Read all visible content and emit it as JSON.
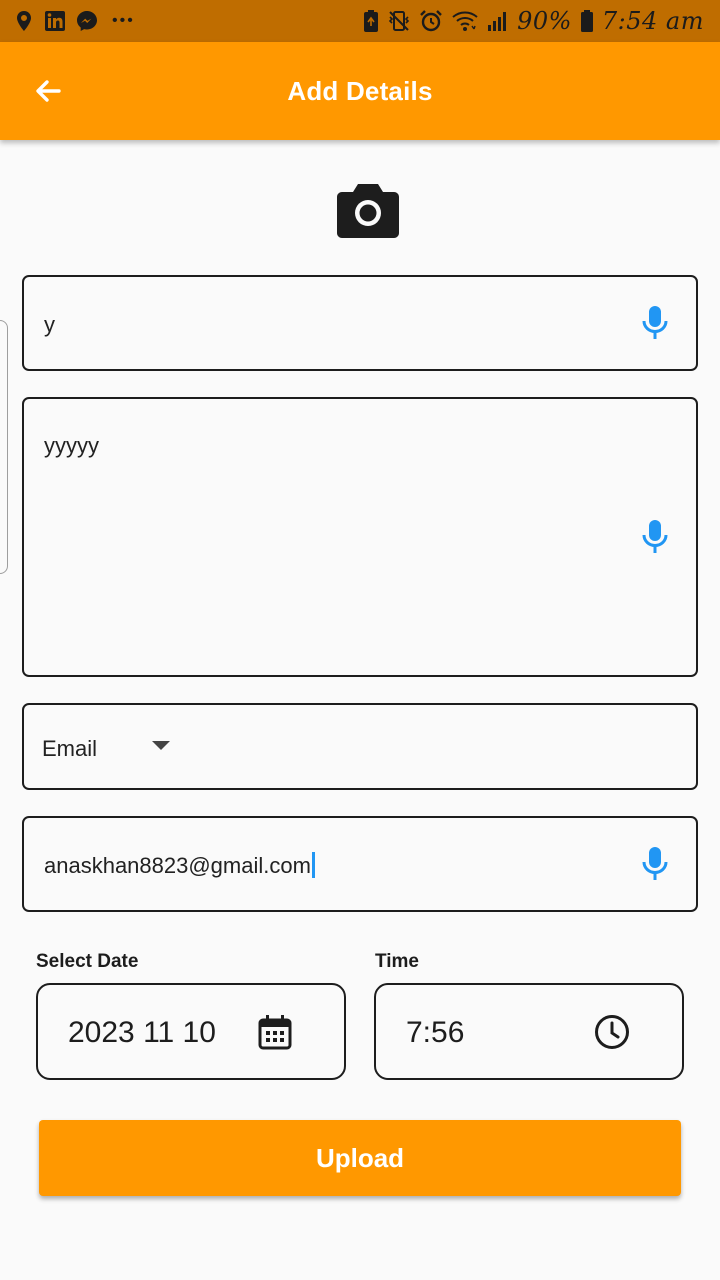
{
  "status_bar": {
    "icons_left": [
      "location-pin-icon",
      "linkedin-icon",
      "messenger-icon",
      "more-dots-icon"
    ],
    "more_dots": "•••",
    "icons_right": [
      "battery-saver-icon",
      "vibrate-icon",
      "alarm-icon",
      "wifi-icon",
      "signal-icon",
      "battery-icon"
    ],
    "battery_text": "90%",
    "time_text": "7:54 am"
  },
  "app_bar": {
    "title": "Add Details",
    "back_icon": "arrow-back-icon",
    "color": "#ff9800"
  },
  "camera": {
    "icon": "camera-icon"
  },
  "form": {
    "title_field": {
      "value": "y",
      "mic_icon": "mic-icon"
    },
    "description_field": {
      "value": "yyyyy",
      "mic_icon": "mic-icon"
    },
    "contact_type": {
      "selected": "Email",
      "icon": "dropdown-arrow-icon"
    },
    "contact_field": {
      "value": "anaskhan8823@gmail.com",
      "mic_icon": "mic-icon"
    },
    "date": {
      "label": "Select Date",
      "value": "2023 11 10",
      "icon": "calendar-icon"
    },
    "time": {
      "label": "Time",
      "value": "7:56",
      "icon": "clock-icon"
    }
  },
  "upload_button": {
    "label": "Upload",
    "color": "#ff9800"
  },
  "colors": {
    "mic": "#2196f3",
    "border": "#1d1d1d",
    "background": "#fafafa"
  }
}
